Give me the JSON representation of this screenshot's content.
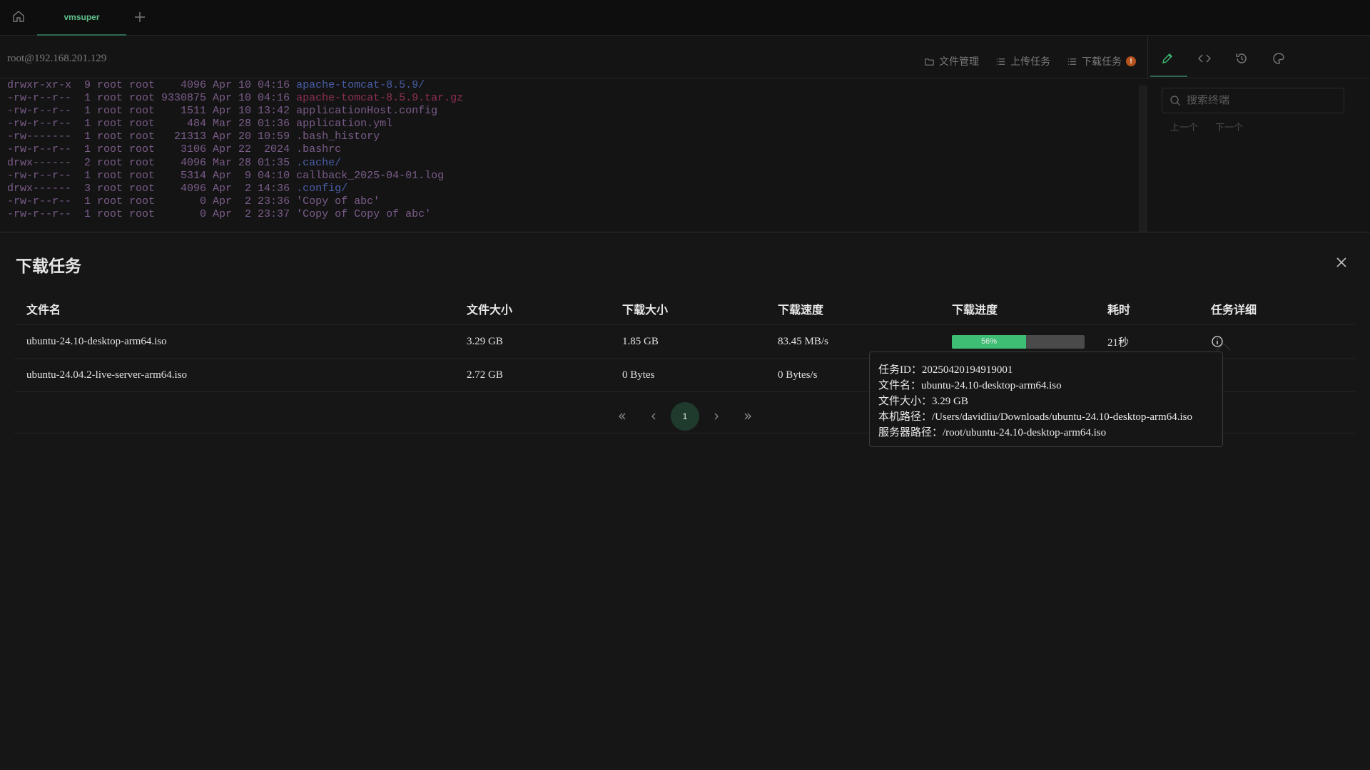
{
  "tabs": [
    {
      "label": "vmsuper"
    }
  ],
  "toolbar": {
    "host": "root@192.168.201.129",
    "file_manager": "文件管理",
    "upload_tasks": "上传任务",
    "download_tasks": "下载任务",
    "download_badge": "!"
  },
  "terminal": {
    "lines": [
      {
        "meta": "drwxr-xr-x  9 root root    4096 Apr 10 04:16 ",
        "name": "apache-tomcat-8.5.9/",
        "kind": "dir"
      },
      {
        "meta": "-rw-r--r--  1 root root 9330875 Apr 10 04:16 ",
        "name": "apache-tomcat-8.5.9.tar.gz",
        "kind": "arc"
      },
      {
        "meta": "-rw-r--r--  1 root root    1511 Apr 10 13:42 ",
        "name": "applicationHost.config",
        "kind": "file"
      },
      {
        "meta": "-rw-r--r--  1 root root     484 Mar 28 01:36 ",
        "name": "application.yml",
        "kind": "file"
      },
      {
        "meta": "-rw-------  1 root root   21313 Apr 20 10:59 ",
        "name": ".bash_history",
        "kind": "file"
      },
      {
        "meta": "-rw-r--r--  1 root root    3106 Apr 22  2024 ",
        "name": ".bashrc",
        "kind": "file"
      },
      {
        "meta": "drwx------  2 root root    4096 Mar 28 01:35 ",
        "name": ".cache/",
        "kind": "dir"
      },
      {
        "meta": "-rw-r--r--  1 root root    5314 Apr  9 04:10 ",
        "name": "callback_2025-04-01.log",
        "kind": "file"
      },
      {
        "meta": "drwx------  3 root root    4096 Apr  2 14:36 ",
        "name": ".config/",
        "kind": "dir"
      },
      {
        "meta": "-rw-r--r--  1 root root       0 Apr  2 23:36 ",
        "name": "'Copy of abc'",
        "kind": "file"
      },
      {
        "meta": "-rw-r--r--  1 root root       0 Apr  2 23:37 ",
        "name": "'Copy of Copy of abc'",
        "kind": "file"
      }
    ]
  },
  "search": {
    "placeholder": "搜索终端",
    "prev": "上一个",
    "next": "下一个"
  },
  "modal": {
    "title": "下载任务",
    "columns": [
      "文件名",
      "文件大小",
      "下载大小",
      "下载速度",
      "下载进度",
      "耗时",
      "任务详细"
    ],
    "rows": [
      {
        "name": "ubuntu-24.10-desktop-arm64.iso",
        "size": "3.29 GB",
        "downloaded": "1.85 GB",
        "speed": "83.45 MB/s",
        "progress": 56,
        "progress_label": "56%",
        "elapsed": "21秒"
      },
      {
        "name": "ubuntu-24.04.2-live-server-arm64.iso",
        "size": "2.72 GB",
        "downloaded": "0 Bytes",
        "speed": "0 Bytes/s",
        "progress": null,
        "progress_label": "",
        "elapsed": ""
      }
    ],
    "pagination": {
      "current": "1"
    },
    "tooltip": {
      "task_id": "任务ID：20250420194919001",
      "file_name": "文件名：ubuntu-24.10-desktop-arm64.iso",
      "file_size": "文件大小：3.29 GB",
      "local_path": "本机路径：/Users/davidliu/Downloads/ubuntu-24.10-desktop-arm64.iso",
      "server_path": "服务器路径：/root/ubuntu-24.10-desktop-arm64.iso"
    }
  },
  "colors": {
    "accent": "#3ebd74",
    "tab_active": "#5fbf8a",
    "badge": "#b4531c"
  }
}
